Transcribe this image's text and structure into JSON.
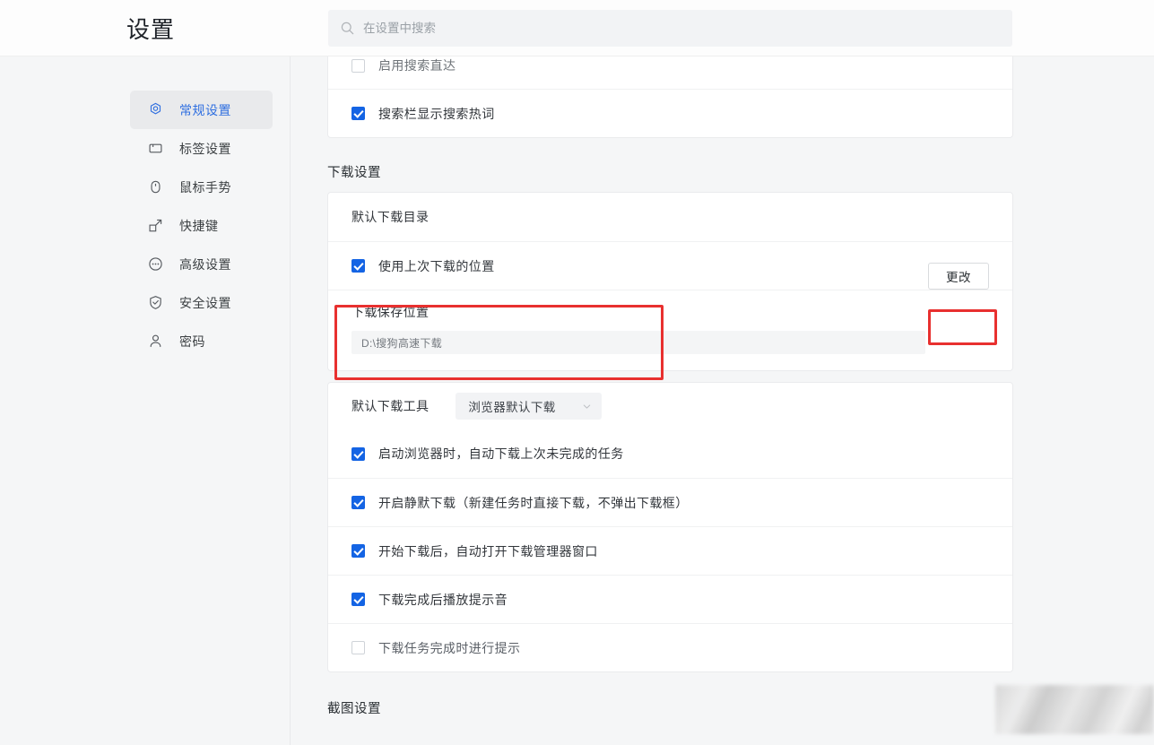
{
  "header": {
    "title": "设置",
    "search": {
      "placeholder": "在设置中搜索",
      "value": "",
      "icon": "search-icon"
    }
  },
  "sidebar": {
    "items": [
      {
        "label": "常规设置",
        "icon": "gear-icon",
        "active": true
      },
      {
        "label": "标签设置",
        "icon": "tab-icon",
        "active": false
      },
      {
        "label": "鼠标手势",
        "icon": "mouse-icon",
        "active": false
      },
      {
        "label": "快捷键",
        "icon": "shortcut-arrow-icon",
        "active": false
      },
      {
        "label": "高级设置",
        "icon": "ellipsis-circle-icon",
        "active": false
      },
      {
        "label": "安全设置",
        "icon": "shield-check-icon",
        "active": false
      },
      {
        "label": "密码",
        "icon": "person-icon",
        "active": false
      }
    ]
  },
  "main": {
    "search_card": {
      "items": [
        {
          "label": "启用搜索直达",
          "checked": false
        },
        {
          "label": "搜索栏显示搜索热词",
          "checked": true
        }
      ]
    },
    "download_section": {
      "title": "下载设置",
      "directory_card": {
        "heading": "默认下载目录",
        "use_last_location": {
          "label": "使用上次下载的位置",
          "checked": true
        },
        "save_path": {
          "title": "下载保存位置",
          "value": "D:\\搜狗高速下载"
        },
        "change_button": {
          "label": "更改"
        }
      },
      "tool_card": {
        "tool_label": "默认下载工具",
        "tool_value": "浏览器默认下载",
        "tool_chevron": "chevron-down-icon",
        "options": [
          {
            "label": "启动浏览器时，自动下载上次未完成的任务",
            "checked": true
          },
          {
            "label": "开启静默下载（新建任务时直接下载，不弹出下载框）",
            "checked": true
          },
          {
            "label": "开始下载后，自动打开下载管理器窗口",
            "checked": true
          },
          {
            "label": "下载完成后播放提示音",
            "checked": true
          },
          {
            "label": "下载任务完成时进行提示",
            "checked": false
          }
        ]
      }
    },
    "screenshot_section": {
      "title": "截图设置"
    }
  },
  "annotations": {
    "highlight_color": "#e8302f",
    "accent_color": "#1464e4",
    "active_nav_color": "#2f6fe0"
  }
}
